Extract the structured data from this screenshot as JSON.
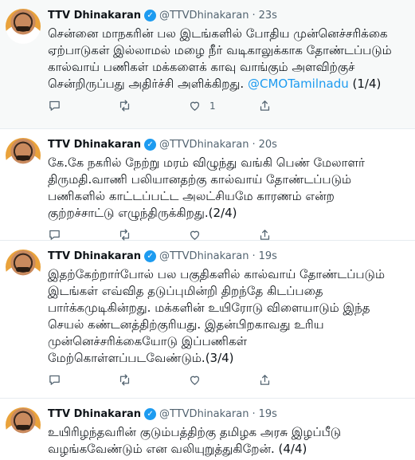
{
  "tweets": [
    {
      "name": "TTV Dhinakaran",
      "handle": "@TTVDhinakaran",
      "time": "23s",
      "text": "சென்னை மாநகரின் பல இடங்களில் போதிய முன்னெச்சரிக்கை ஏற்பாடுகள் இல்லாமல் மழை நீர் வடிகாலுக்காக தோண்டப்படும் கால்வாய் பணிகள் மக்களைக் காவு வாங்கும் அளவிற்குச் சென்றிருப்பது அதிர்ச்சி அளிக்கிறது.",
      "mention": "@CMOTamilnadu",
      "suffix": "(1/4)",
      "like_count": "1"
    },
    {
      "name": "TTV Dhinakaran",
      "handle": "@TTVDhinakaran",
      "time": "20s",
      "text": "கே.கே நகரில் நேற்று மரம் விழுந்து வங்கி பெண் மேலாளர் திருமதி.வாணி பலியானதற்கு கால்வாய் தோண்டப்படும் பணிகளில் காட்டப்பட்ட அலட்சியமே காரணம் என்ற குற்றச்சாட்டு எழுந்திருக்கிறது.(2/4)"
    },
    {
      "name": "TTV Dhinakaran",
      "handle": "@TTVDhinakaran",
      "time": "19s",
      "text": "இதற்கேற்றார்போல் பல பகுதிகளில் கால்வாய் தோண்டப்படும் இடங்கள் எவ்வித தடுப்புமின்றி திறந்தே கிடப்பதை பார்க்கமுடிகின்றது. மக்களின் உயிரோடு விளையாடும் இந்த செயல் கண்டனத்திற்குரியது. இதன்பிறகாவது உரிய முன்னெச்சரிக்கையோடு இப்பணிகள் மேற்கொள்ளப்படவேண்டும்.(3/4)"
    },
    {
      "name": "TTV Dhinakaran",
      "handle": "@TTVDhinakaran",
      "time": "19s",
      "text": "உயிரிழந்தவரின் குடும்பத்திற்கு தமிழக அரசு இழப்பீடு வழங்கவேண்டும் என வலியுறுத்துகிறேன். (4/4)"
    }
  ],
  "icons": {
    "verified": "verified-badge-icon",
    "reply": "reply-icon",
    "retweet": "retweet-icon",
    "like": "heart-icon",
    "share": "share-icon"
  },
  "colors": {
    "accent": "#1d9bf0",
    "muted": "#536471",
    "highlight_bg": "#f7f9f9"
  }
}
